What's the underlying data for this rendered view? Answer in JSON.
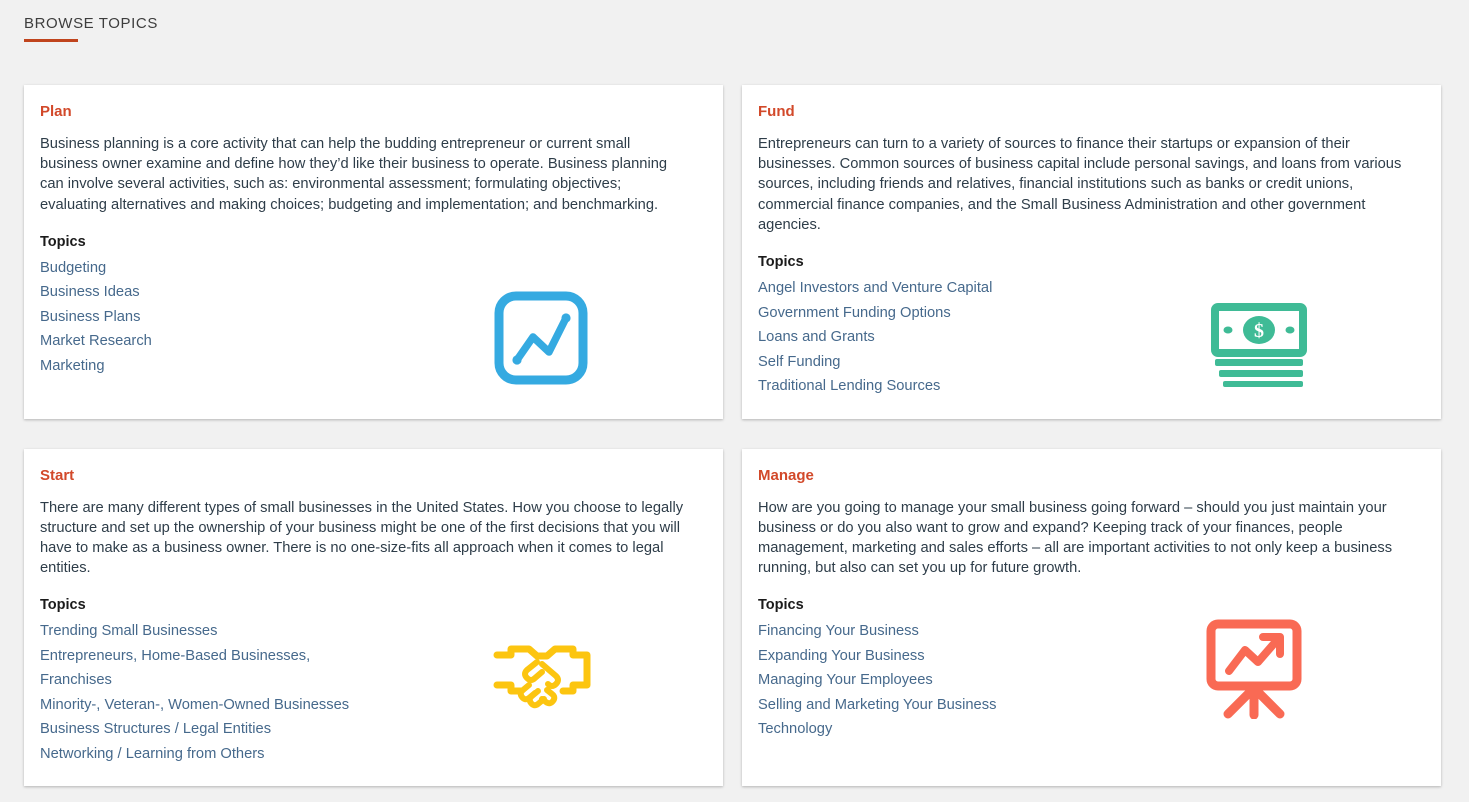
{
  "section": {
    "label": "BROWSE TOPICS",
    "accent_color": "#c0441d"
  },
  "colors": {
    "page_background": "#f1f1f1",
    "card_background": "#ffffff",
    "card_title": "#d2492a",
    "body_text": "#2e3d49",
    "link": "#46698c",
    "icon_plan": "#35aae1",
    "icon_fund": "#3fbb96",
    "icon_start": "#fcc510",
    "icon_manage": "#f96a54"
  },
  "topics_heading": "Topics",
  "cards": [
    {
      "title": "Plan",
      "description": "Business planning is a core activity that can help the budding entrepreneur or current small business owner examine and define how they’d like their business to operate. Business planning can involve several activities, such as: environmental assessment; formulating objectives; evaluating alternatives and making choices; budgeting and implementation; and benchmarking.",
      "icon": "line-chart-icon",
      "icon_color": "#35aae1",
      "topics": [
        "Budgeting",
        "Business Ideas",
        "Business Plans",
        "Market Research",
        "Marketing"
      ]
    },
    {
      "title": "Fund",
      "description": "Entrepreneurs can turn to a variety of sources to finance their startups or expansion of their businesses. Common sources of business capital include personal savings, and loans from various sources, including friends and relatives, financial institutions such as banks or credit unions, commercial finance companies, and the Small Business Administration and other government agencies.",
      "icon": "cash-stack-icon",
      "icon_color": "#3fbb96",
      "topics": [
        "Angel Investors and Venture Capital",
        "Government Funding Options",
        "Loans and Grants",
        "Self Funding",
        "Traditional Lending Sources"
      ]
    },
    {
      "title": "Start",
      "description": "There are many different types of small businesses in the United States. How you choose to legally structure and set up the ownership of your business might be one of the first decisions that you will have to make as a business owner. There is no one-size-fits all approach when it comes to legal entities.",
      "icon": "handshake-icon",
      "icon_color": "#fcc510",
      "topics": [
        "Trending Small Businesses",
        "Entrepreneurs, Home-Based Businesses, Franchises",
        "Minority-, Veteran-, Women-Owned Businesses",
        "Business Structures / Legal Entities",
        "Networking / Learning from Others"
      ]
    },
    {
      "title": "Manage",
      "description": "How are you going to manage your small business going forward – should you just maintain your business or do you also want to grow and expand? Keeping track of your finances, people management, marketing and sales efforts – all are important activities to not only keep a business running, but also can set you up for future growth.",
      "icon": "presentation-growth-icon",
      "icon_color": "#f96a54",
      "topics": [
        "Financing Your Business",
        "Expanding Your Business",
        "Managing Your Employees",
        "Selling and Marketing Your Business",
        "Technology"
      ]
    }
  ]
}
